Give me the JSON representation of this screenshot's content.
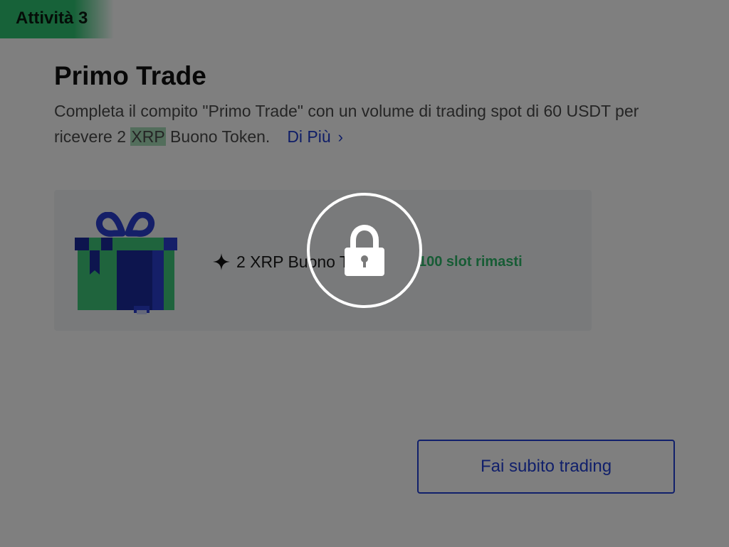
{
  "task": {
    "badge": "Attività 3",
    "title": "Primo Trade",
    "description_before": "Completa il compito \"Primo Trade\" con un volume di trading spot di 60 USDT per ricevere 2 ",
    "description_highlight": "XRP",
    "description_after": " Buono Token.",
    "more_link": "Di Più"
  },
  "reward": {
    "label": "2 XRP Buono Token",
    "slots": "100 slot rimasti",
    "icon": "gift-box-icon"
  },
  "actions": {
    "trade_button": "Fai subito trading"
  },
  "overlay": {
    "icon": "lock-icon"
  },
  "colors": {
    "badge_green": "#2fc472",
    "link_blue": "#1e3bcf",
    "button_blue": "#2340d6",
    "slots_green": "#2fb86a",
    "highlight_green": "#a7ddb9"
  }
}
